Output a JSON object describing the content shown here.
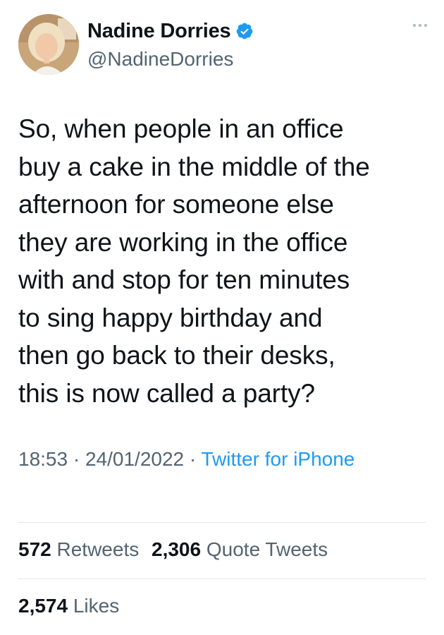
{
  "author": {
    "display_name": "Nadine Dorries",
    "handle": "@NadineDorries",
    "verified": true,
    "avatar_icon": "profile-photo"
  },
  "tweet": {
    "text": "So, when people in an office\nbuy a cake in the middle of the\nafternoon for someone else\nthey are working in the office\nwith and stop for ten minutes\nto sing happy birthday and\nthen go back to their desks,\nthis is now called a party?",
    "time": "18:53",
    "separator": "·",
    "date": "24/01/2022",
    "source": "Twitter for iPhone"
  },
  "stats": {
    "retweets_count": "572",
    "retweets_label": "Retweets",
    "quotes_count": "2,306",
    "quotes_label": "Quote Tweets",
    "likes_count": "2,574",
    "likes_label": "Likes"
  },
  "colors": {
    "text_primary": "#0f1419",
    "text_secondary": "#536471",
    "accent": "#1d9bf0",
    "divider": "#e1e5e8"
  },
  "icons": {
    "verified": "verified-badge-icon",
    "more": "more-options-icon"
  }
}
